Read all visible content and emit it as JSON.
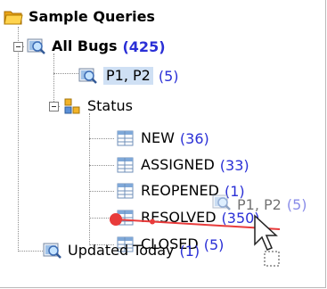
{
  "tree": {
    "root": {
      "label": "Sample Queries",
      "icon": "folder-icon"
    },
    "all_bugs": {
      "label": "All Bugs",
      "count": "(425)",
      "icon": "query-icon"
    },
    "p1p2": {
      "label": "P1, P2",
      "count": "(5)",
      "icon": "query-icon"
    },
    "status": {
      "label": "Status",
      "icon": "group-icon"
    },
    "statuses": [
      {
        "label": "NEW",
        "count": "(36)"
      },
      {
        "label": "ASSIGNED",
        "count": "(33)"
      },
      {
        "label": "REOPENED",
        "count": "(1)"
      },
      {
        "label": "RESOLVED",
        "count": "(350)"
      },
      {
        "label": "CLOSED",
        "count": "(5)"
      }
    ],
    "updated_today": {
      "label": "Updated Today",
      "count": "(1)",
      "icon": "query-icon"
    }
  },
  "drag": {
    "label": "P1, P2",
    "count": "(5)"
  },
  "colors": {
    "count": "#2a2fd6",
    "selection": "#cfe0f4",
    "drop_indicator": "#e83b3b"
  }
}
